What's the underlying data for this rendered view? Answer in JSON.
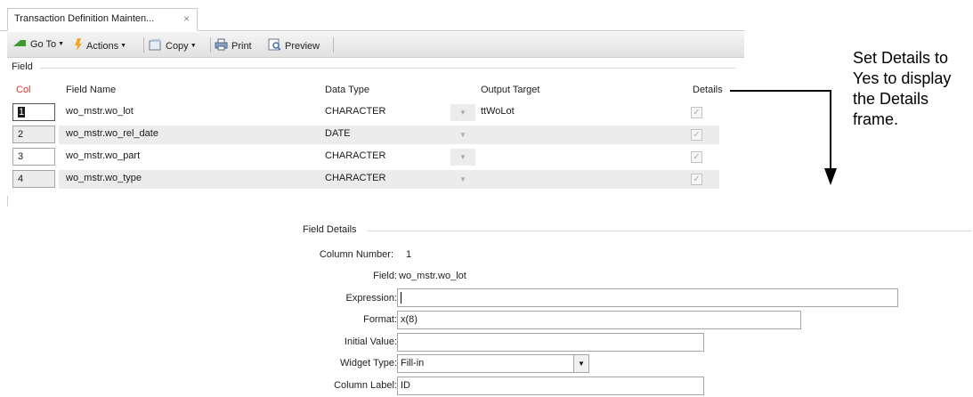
{
  "tab": {
    "title": "Transaction Definition Mainten...",
    "close": "×"
  },
  "toolbar": {
    "goto": "Go To",
    "actions": "Actions",
    "copy": "Copy",
    "print": "Print",
    "preview": "Preview"
  },
  "field_section": {
    "title": "Field",
    "headers": {
      "col": "Col",
      "field_name": "Field Name",
      "data_type": "Data Type",
      "output_target": "Output Target",
      "details": "Details"
    },
    "rows": [
      {
        "col": "1",
        "field_name": "wo_mstr.wo_lot",
        "data_type": "CHARACTER",
        "output_target": "ttWoLot",
        "details": true
      },
      {
        "col": "2",
        "field_name": "wo_mstr.wo_rel_date",
        "data_type": "DATE",
        "output_target": "",
        "details": true
      },
      {
        "col": "3",
        "field_name": "wo_mstr.wo_part",
        "data_type": "CHARACTER",
        "output_target": "",
        "details": true
      },
      {
        "col": "4",
        "field_name": "wo_mstr.wo_type",
        "data_type": "CHARACTER",
        "output_target": "",
        "details": true
      }
    ]
  },
  "annotation": {
    "text": "Set Details to Yes to display the Details frame."
  },
  "details": {
    "title": "Field Details",
    "column_number_label": "Column Number:",
    "column_number": "1",
    "field_label": "Field:",
    "field": "wo_mstr.wo_lot",
    "expression_label": "Expression:",
    "expression": "",
    "format_label": "Format:",
    "format": "x(8)",
    "initial_value_label": "Initial Value:",
    "initial_value": "",
    "widget_type_label": "Widget Type:",
    "widget_type": "Fill-in",
    "column_label_label": "Column Label:",
    "column_label": "ID"
  },
  "colors": {
    "col_header": "#d9322b",
    "alt_row": "#ececec"
  },
  "icons": [
    "goto-icon",
    "actions-icon",
    "copy-icon",
    "print-icon",
    "preview-icon",
    "close-icon",
    "dropdown-icon",
    "checkbox-icon"
  ]
}
